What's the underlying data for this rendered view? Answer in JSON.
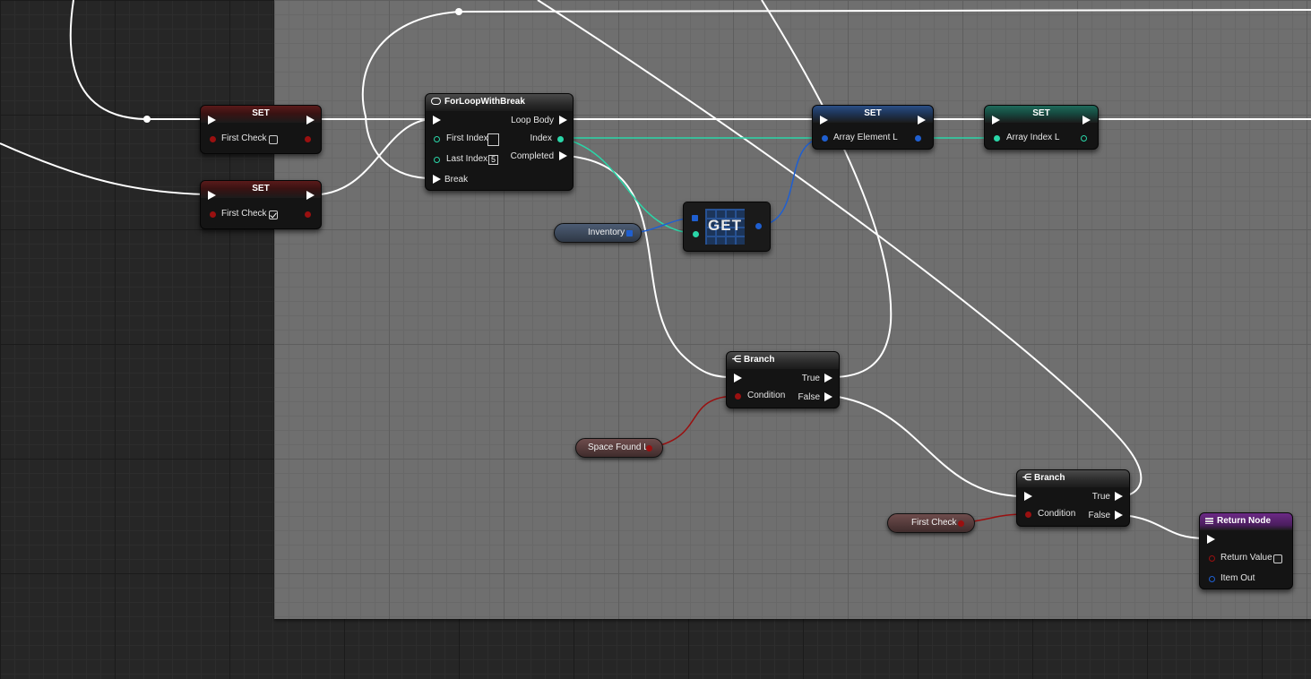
{
  "set_first_check_a": {
    "title": "SET",
    "var_label": "First Check",
    "checked": false
  },
  "set_first_check_b": {
    "title": "SET",
    "var_label": "First Check",
    "checked": true
  },
  "for_loop": {
    "title": "ForLoopWithBreak",
    "first_index_label": "First Index",
    "first_index_value": "",
    "last_index_label": "Last Index",
    "last_index_value": "5",
    "break_label": "Break",
    "loop_body_label": "Loop Body",
    "index_label": "Index",
    "completed_label": "Completed"
  },
  "set_array_element": {
    "title": "SET",
    "var_label": "Array Element L"
  },
  "set_array_index": {
    "title": "SET",
    "var_label": "Array Index L"
  },
  "get_node": {
    "title": "GET"
  },
  "inventory_var": {
    "label": "Inventory"
  },
  "branch_1": {
    "title": "Branch",
    "condition_label": "Condition",
    "true_label": "True",
    "false_label": "False"
  },
  "space_found_var": {
    "label": "Space Found L"
  },
  "branch_2": {
    "title": "Branch",
    "condition_label": "Condition",
    "true_label": "True",
    "false_label": "False"
  },
  "first_check_var": {
    "label": "First Check"
  },
  "return_node": {
    "title": "Return Node",
    "return_value_label": "Return Value",
    "return_value_checked": false,
    "item_out_label": "Item Out"
  },
  "colors": {
    "exec_wire": "#ffffff",
    "bool_pin": "#9a1010",
    "int_pin": "#2ad6a8",
    "struct_pin": "#1f5fd0",
    "return_header": "#6c2a86"
  }
}
